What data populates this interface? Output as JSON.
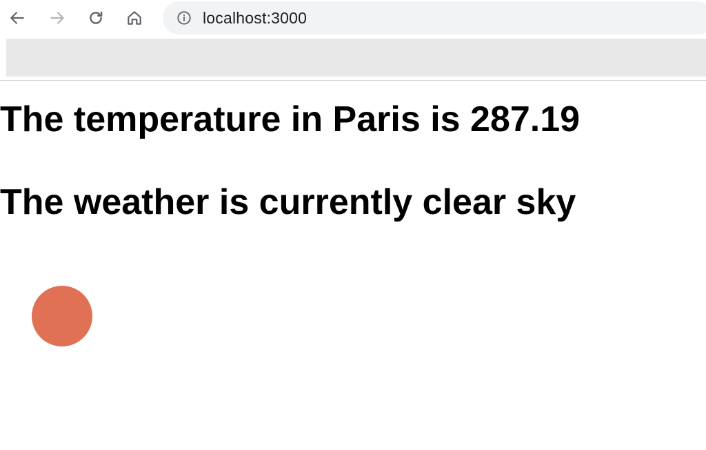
{
  "browser": {
    "url": "localhost:3000",
    "icons": {
      "back": "arrow-left-icon",
      "forward": "arrow-right-icon",
      "reload": "reload-icon",
      "home": "home-icon",
      "info": "info-icon"
    }
  },
  "page": {
    "temperature_text": "The temperature in Paris is 287.19",
    "weather_text": "The weather is currently clear sky",
    "circle_color": "#e07155"
  }
}
